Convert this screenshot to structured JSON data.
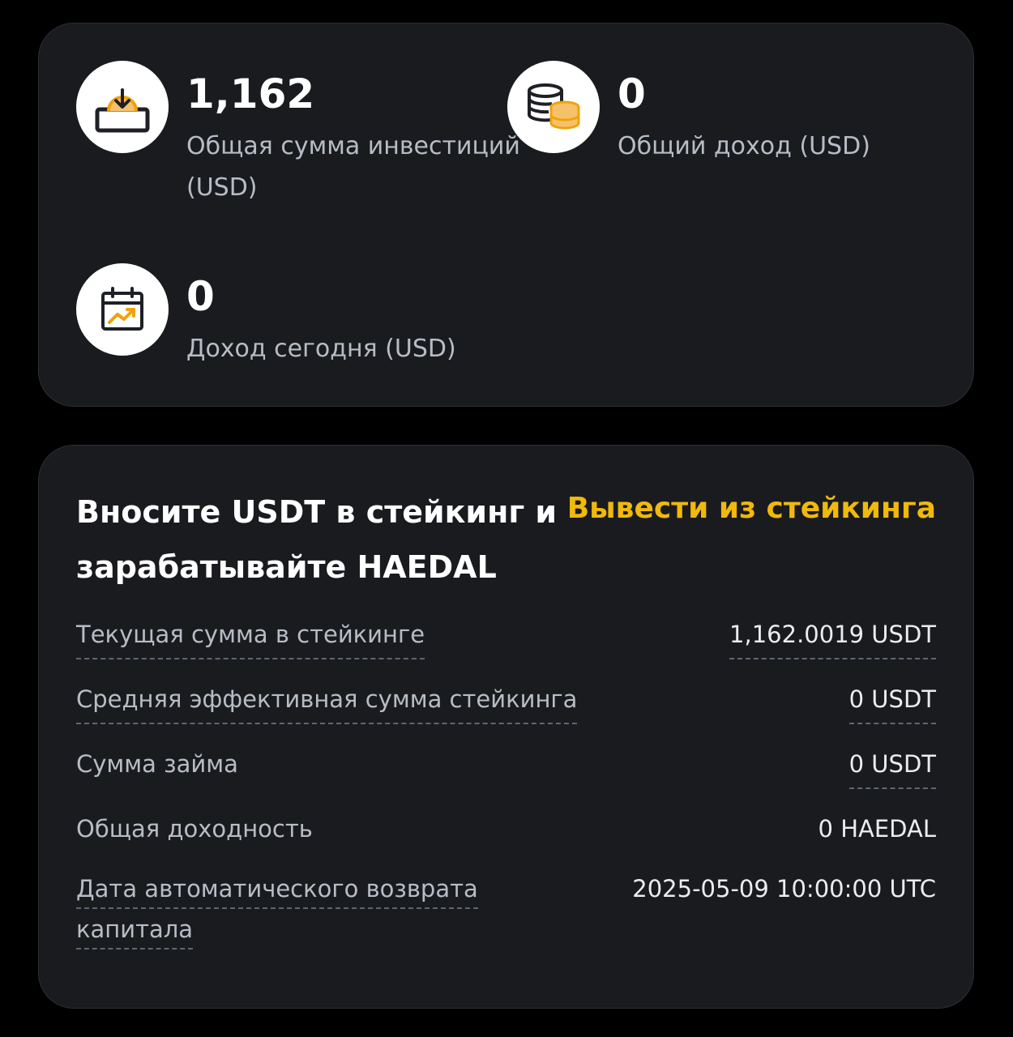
{
  "stats": {
    "invested": {
      "value": "1,162",
      "label": "Общая сумма инвестиций (USD)",
      "icon": "download-tray-icon"
    },
    "total_income": {
      "value": "0",
      "label": "Общий доход (USD)",
      "icon": "coins-stack-icon"
    },
    "today_income": {
      "value": "0",
      "label": "Доход сегодня (USD)",
      "icon": "calendar-chart-icon"
    }
  },
  "staking": {
    "title": "Вносите USDT в стейкинг и зарабатывайте HAEDAL",
    "unstake_label": "Вывести из стейкинга",
    "rows": [
      {
        "label": "Текущая сумма в стейкинге",
        "value": "1,162.0019 USDT"
      },
      {
        "label": "Средняя эффективная сумма стейкинга",
        "value": "0 USDT"
      },
      {
        "label": "Сумма займа",
        "value": "0 USDT"
      },
      {
        "label": "Общая доходность",
        "value": "0 HAEDAL"
      },
      {
        "label": "Дата автоматического возврата капитала",
        "value": "2025-05-09 10:00:00 UTC"
      }
    ]
  },
  "colors": {
    "background": "#000000",
    "card": "#1a1b1f",
    "accent": "#f0b90b",
    "text_primary": "#ffffff",
    "text_secondary": "#b7bdc6"
  }
}
